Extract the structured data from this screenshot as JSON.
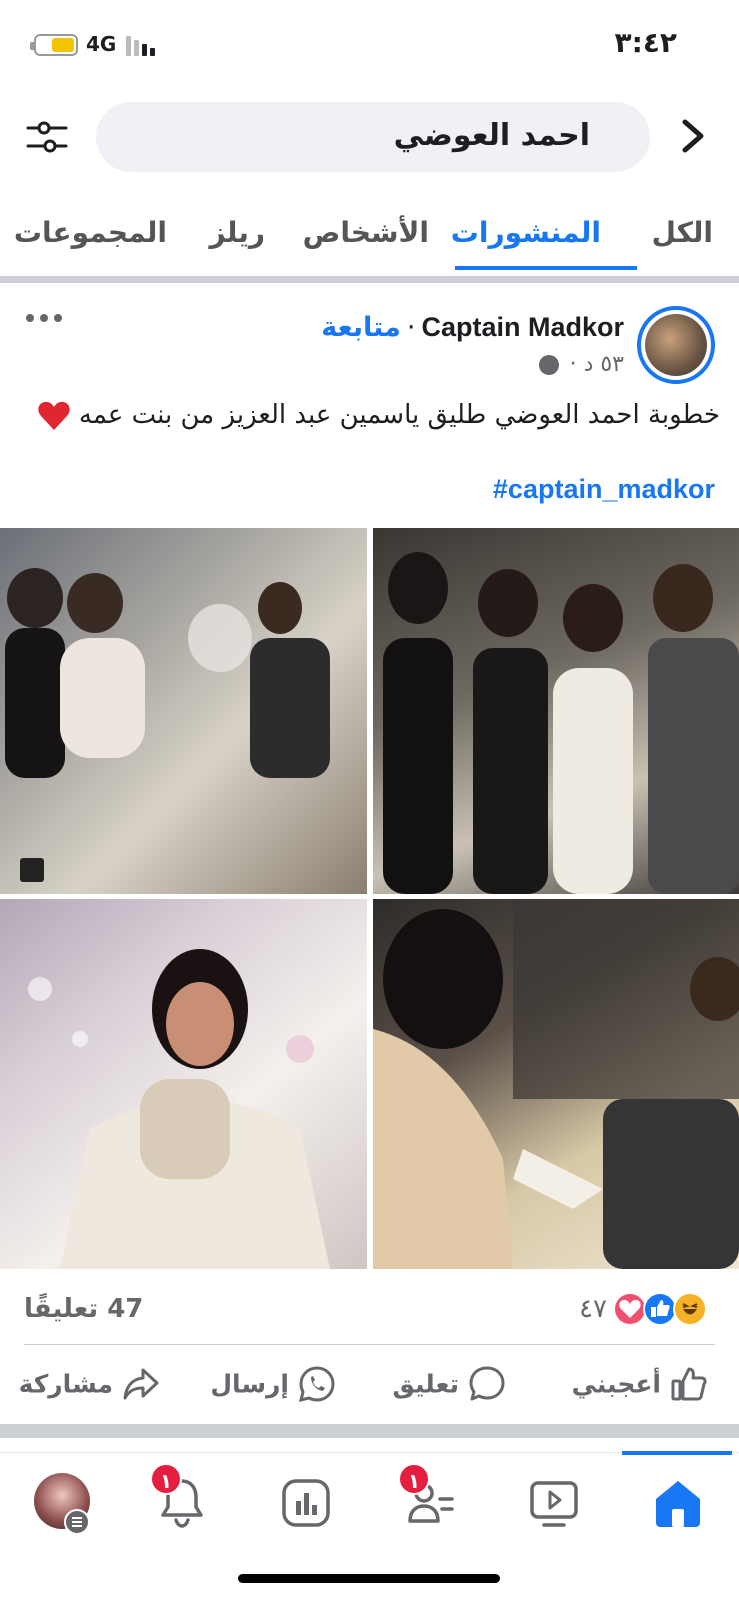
{
  "status_bar": {
    "time": "٣:٤٢",
    "network": "4G"
  },
  "search": {
    "query": "احمد العوضي"
  },
  "tabs": [
    {
      "label": "الكل",
      "active": false
    },
    {
      "label": "المنشورات",
      "active": true
    },
    {
      "label": "الأشخاص",
      "active": false
    },
    {
      "label": "ريلز",
      "active": false
    },
    {
      "label": "المجموعات",
      "active": false
    }
  ],
  "post": {
    "author": "Captain Madkor",
    "separator": "·",
    "follow_label": "متابعة",
    "timestamp": "٥٣ د ·",
    "text": "خطوبة احمد العوضي طليق ياسمين عبد العزيز من بنت عمه",
    "hashtag": "#captain_madkor",
    "reaction_count": "٤٧",
    "comment_count": "47 تعليقًا",
    "actions": {
      "like": "أعجبني",
      "comment": "تعليق",
      "send": "إرسال",
      "share": "مشاركة"
    }
  },
  "bottom_nav": {
    "notifications_badge": "١",
    "friends_badge": "١"
  },
  "colors": {
    "accent": "#1877f2",
    "badge": "#e41e3f",
    "muted": "#65676b"
  }
}
